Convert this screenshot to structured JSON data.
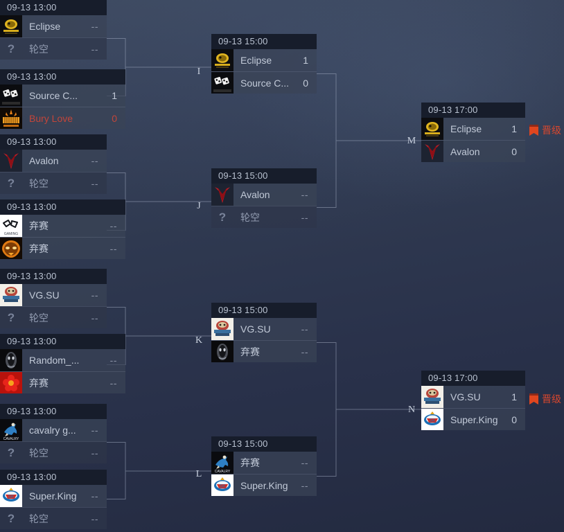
{
  "theme": {
    "bg_top": "#3e4a60",
    "bg_bottom": "#232a40",
    "card_bg": "#202738",
    "row_bg": "#6a768c",
    "time_bg": "#171d2b",
    "text": "#c2cad8",
    "muted_text": "#8b93a6",
    "loser_text": "#c2453a",
    "advance_color": "#d8472e",
    "connector_line": "#9aa4ba"
  },
  "labels": {
    "bye": "轮空",
    "forfeit": "弃赛",
    "no_score": "--",
    "advance": "晋级",
    "placeholder_logo": "?"
  },
  "rounds": [
    {
      "name": "round-1",
      "matches": [
        {
          "id": "r1m1",
          "time": "09-13 13:00",
          "teams": [
            {
              "name": "Eclipse",
              "score": "--",
              "logo": "eclipse",
              "state": "normal"
            },
            {
              "name": "轮空",
              "score": "--",
              "logo": "placeholder",
              "state": "bye"
            }
          ]
        },
        {
          "id": "r1m2",
          "time": "09-13 13:00",
          "teams": [
            {
              "name": "Source C...",
              "score": "1",
              "logo": "source-club",
              "state": "normal"
            },
            {
              "name": "Bury Love",
              "score": "0",
              "logo": "bury-love",
              "state": "loser"
            }
          ]
        },
        {
          "id": "r1m3",
          "time": "09-13 13:00",
          "teams": [
            {
              "name": "Avalon",
              "score": "--",
              "logo": "avalon",
              "state": "normal"
            },
            {
              "name": "轮空",
              "score": "--",
              "logo": "placeholder",
              "state": "bye"
            }
          ]
        },
        {
          "id": "r1m4",
          "time": "09-13 13:00",
          "teams": [
            {
              "name": "弃赛",
              "score": "--",
              "logo": "gaming-white",
              "state": "normal"
            },
            {
              "name": "弃赛",
              "score": "--",
              "logo": "orange-demon",
              "state": "normal"
            }
          ]
        },
        {
          "id": "r1m5",
          "time": "09-13 13:00",
          "teams": [
            {
              "name": "VG.SU",
              "score": "--",
              "logo": "vg-su",
              "state": "normal"
            },
            {
              "name": "轮空",
              "score": "--",
              "logo": "placeholder",
              "state": "bye"
            }
          ]
        },
        {
          "id": "r1m6",
          "time": "09-13 13:00",
          "teams": [
            {
              "name": "Random_...",
              "score": "--",
              "logo": "random-dark",
              "state": "normal"
            },
            {
              "name": "弃赛",
              "score": "--",
              "logo": "red-flower",
              "state": "normal"
            }
          ]
        },
        {
          "id": "r1m7",
          "time": "09-13 13:00",
          "teams": [
            {
              "name": "cavalry g...",
              "score": "--",
              "logo": "cavalry",
              "state": "normal"
            },
            {
              "name": "轮空",
              "score": "--",
              "logo": "placeholder",
              "state": "bye"
            }
          ]
        },
        {
          "id": "r1m8",
          "time": "09-13 13:00",
          "teams": [
            {
              "name": "Super.King",
              "score": "--",
              "logo": "super-king",
              "state": "normal"
            },
            {
              "name": "轮空",
              "score": "--",
              "logo": "placeholder",
              "state": "bye"
            }
          ]
        }
      ]
    },
    {
      "name": "round-2",
      "matches": [
        {
          "id": "I",
          "letter": "I",
          "time": "09-13 15:00",
          "teams": [
            {
              "name": "Eclipse",
              "score": "1",
              "logo": "eclipse",
              "state": "normal"
            },
            {
              "name": "Source C...",
              "score": "0",
              "logo": "source-club",
              "state": "normal"
            }
          ]
        },
        {
          "id": "J",
          "letter": "J",
          "time": "09-13 15:00",
          "teams": [
            {
              "name": "Avalon",
              "score": "--",
              "logo": "avalon",
              "state": "normal"
            },
            {
              "name": "轮空",
              "score": "--",
              "logo": "placeholder",
              "state": "bye"
            }
          ]
        },
        {
          "id": "K",
          "letter": "K",
          "time": "09-13 15:00",
          "teams": [
            {
              "name": "VG.SU",
              "score": "--",
              "logo": "vg-su",
              "state": "normal"
            },
            {
              "name": "弃赛",
              "score": "--",
              "logo": "random-dark",
              "state": "normal"
            }
          ]
        },
        {
          "id": "L",
          "letter": "L",
          "time": "09-13 15:00",
          "teams": [
            {
              "name": "弃赛",
              "score": "--",
              "logo": "cavalry",
              "state": "normal"
            },
            {
              "name": "Super.King",
              "score": "--",
              "logo": "super-king",
              "state": "normal"
            }
          ]
        }
      ]
    },
    {
      "name": "round-3",
      "matches": [
        {
          "id": "M",
          "letter": "M",
          "time": "09-13 17:00",
          "advance": "晋级",
          "teams": [
            {
              "name": "Eclipse",
              "score": "1",
              "logo": "eclipse",
              "state": "normal"
            },
            {
              "name": "Avalon",
              "score": "0",
              "logo": "avalon",
              "state": "normal"
            }
          ]
        },
        {
          "id": "N",
          "letter": "N",
          "time": "09-13 17:00",
          "advance": "晋级",
          "teams": [
            {
              "name": "VG.SU",
              "score": "1",
              "logo": "vg-su",
              "state": "normal"
            },
            {
              "name": "Super.King",
              "score": "0",
              "logo": "super-king",
              "state": "normal"
            }
          ]
        }
      ]
    }
  ]
}
